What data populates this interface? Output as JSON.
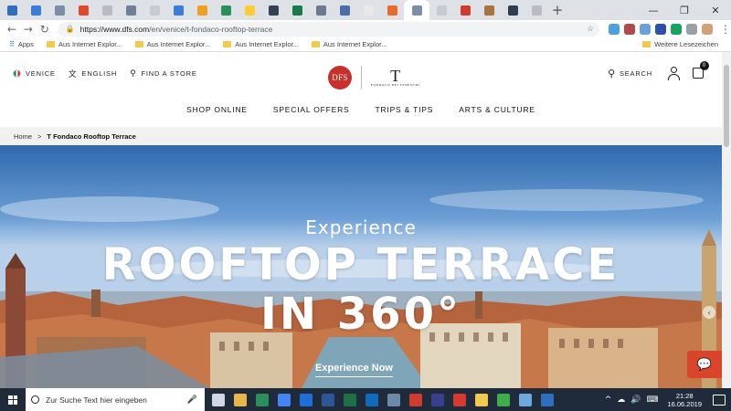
{
  "browser": {
    "tab_colors": [
      "#2f6fc0",
      "#3b7dd8",
      "#7a8ea8",
      "#e04a2a",
      "#b9bcc2",
      "#6d7f99",
      "#c7cad0",
      "#3b7dd8",
      "#f0a020",
      "#2b8f5a",
      "#ffcc33",
      "#344055",
      "#1a7a4c",
      "#6b7b8f",
      "#4a6fa8",
      "#e8e8e8",
      "#ea6a2c",
      "#7a8ea8",
      "#c7cad0",
      "#d13a2e",
      "#a8733e",
      "#2c3e50",
      "#b9bcc2"
    ],
    "new_tab_label": "+",
    "window_controls": {
      "minimize": "—",
      "maximize": "❐",
      "close": "✕"
    },
    "nav": {
      "back": "←",
      "forward": "→",
      "reload": "↻"
    },
    "url_host": "https://www.dfs.com",
    "url_path": "/en/venice/t-fondaco-rooftop-terrace",
    "star": "☆",
    "extension_colors": [
      "#4aa3df",
      "#b04a4a",
      "#6d9fd8",
      "#2f4fa8",
      "#1aa260",
      "#9aa0a6",
      "#cfa37a"
    ],
    "menu": "⋮"
  },
  "bookmarks": {
    "apps_label": "Apps",
    "items": [
      "Aus Internet Explor...",
      "Aus Internet Explor...",
      "Aus Internet Explor...",
      "Aus Internet Explor..."
    ],
    "other_label": "Weitere Lesezeichen"
  },
  "site": {
    "location": "VENICE",
    "language": "ENGLISH",
    "store_finder": "FIND A STORE",
    "logo_text": "DFS",
    "brand_letter": "T",
    "brand_sub": "FONDACO DEI TEDESCHI",
    "search_label": "SEARCH",
    "bag_count": "0",
    "nav_items": [
      "SHOP ONLINE",
      "SPECIAL OFFERS",
      "TRIPS & TIPS",
      "ARTS & CULTURE"
    ]
  },
  "breadcrumb": {
    "home": "Home",
    "separator": ">",
    "current": "T Fondaco Rooftop Terrace"
  },
  "hero": {
    "eyebrow": "Experience",
    "title_line1": "ROOFTOP TERRACE",
    "title_line2": "IN 360°",
    "cta": "Experience Now",
    "arrow": "‹",
    "chat_glyph": "💬"
  },
  "taskbar": {
    "search_placeholder": "Zur Suche Text hier eingeben",
    "mic": "🎤",
    "app_colors": [
      "#cfd8e3",
      "#e8b64a",
      "#2b8f5a",
      "#4285f4",
      "#1e6fd9",
      "#2b579a",
      "#1e7145",
      "#0f6cbd",
      "#6e8aa8",
      "#d13a2e",
      "#3b3f8f",
      "#d63a2e",
      "#f2c94c",
      "#3dae4a",
      "#6fa8dc",
      "#2f6fc0"
    ],
    "tray_glyphs": [
      "^",
      "☁",
      "🔊",
      "⌨"
    ],
    "time": "21:28",
    "date": "16.06.2019"
  }
}
